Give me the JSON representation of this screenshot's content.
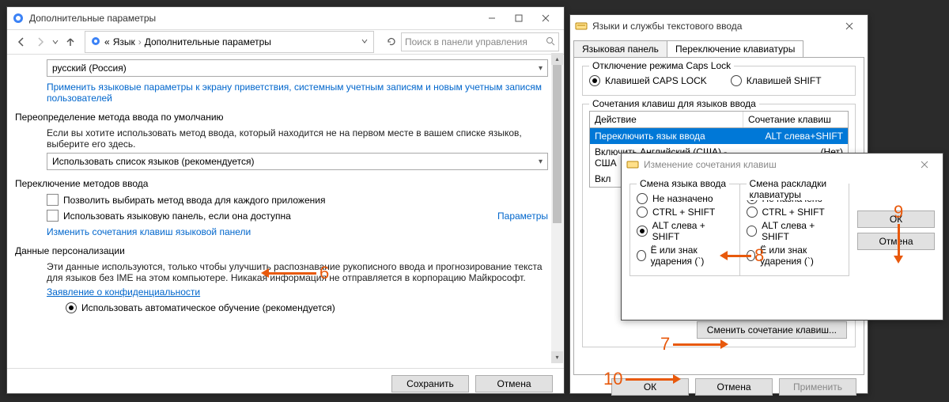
{
  "win1": {
    "title": "Дополнительные параметры",
    "breadcrumb_prefix": "«",
    "breadcrumb1": "Язык",
    "breadcrumb2": "Дополнительные параметры",
    "search_placeholder": "Поиск в панели управления",
    "language_value": "русский (Россия)",
    "apply_welcome_link": "Применить языковые параметры к экрану приветствия, системным учетным записям и новым учетным записям пользователей",
    "section_override": "Переопределение метода ввода по умолчанию",
    "override_help": "Если вы хотите использовать метод ввода, который находится не на первом месте в вашем списке языков, выберите его здесь.",
    "input_method_value": "Использовать список языков (рекомендуется)",
    "section_switch": "Переключение методов ввода",
    "cb_per_app": "Позволить выбирать метод ввода для каждого приложения",
    "cb_lang_bar": "Использовать языковую панель, если она доступна",
    "params_link": "Параметры",
    "change_hotkeys_link": "Изменить сочетания клавиш языковой панели",
    "section_personal": "Данные персонализации",
    "personal_help": "Эти данные используются, только чтобы улучшить распознавание рукописного ввода и прогнозирование текста для языков без IME на этом компьютере. Никакая информация не отправляется в корпорацию Майкрософт.",
    "privacy_link": "Заявление о конфиденциальности",
    "radio_auto": "Использовать автоматическое обучение (рекомендуется)",
    "btn_save": "Сохранить",
    "btn_cancel": "Отмена"
  },
  "win2": {
    "title": "Языки и службы текстового ввода",
    "tab1": "Языковая панель",
    "tab2": "Переключение клавиатуры",
    "caps_group": "Отключение режима Caps Lock",
    "caps_opt1": "Клавишей CAPS LOCK",
    "caps_opt2": "Клавишей SHIFT",
    "hotkeys_group": "Сочетания клавиш для языков ввода",
    "col_action": "Действие",
    "col_combo": "Сочетание клавиш",
    "row1_action": "Переключить язык ввода",
    "row1_combo": "ALT слева+SHIFT",
    "row2_action": "Включить Английский (США) - США",
    "row2_combo": "(Нет)",
    "row3_action": "Вкл",
    "btn_change_combo": "Сменить сочетание клавиш...",
    "btn_ok": "ОК",
    "btn_cancel": "Отмена",
    "btn_apply": "Применить"
  },
  "win3": {
    "title": "Изменение сочетания клавиш",
    "col1_title": "Смена языка ввода",
    "col2_title": "Смена раскладки клавиатуры",
    "opt_none": "Не назначено",
    "opt_ctrlshift": "CTRL + SHIFT",
    "opt_altshift": "ALT слева + SHIFT",
    "opt_grave": "Ё или знак ударения (`)",
    "btn_ok": "ОК",
    "btn_cancel": "Отмена"
  },
  "callouts": {
    "c6": "6",
    "c7": "7",
    "c8": "8",
    "c9": "9",
    "c10": "10"
  }
}
